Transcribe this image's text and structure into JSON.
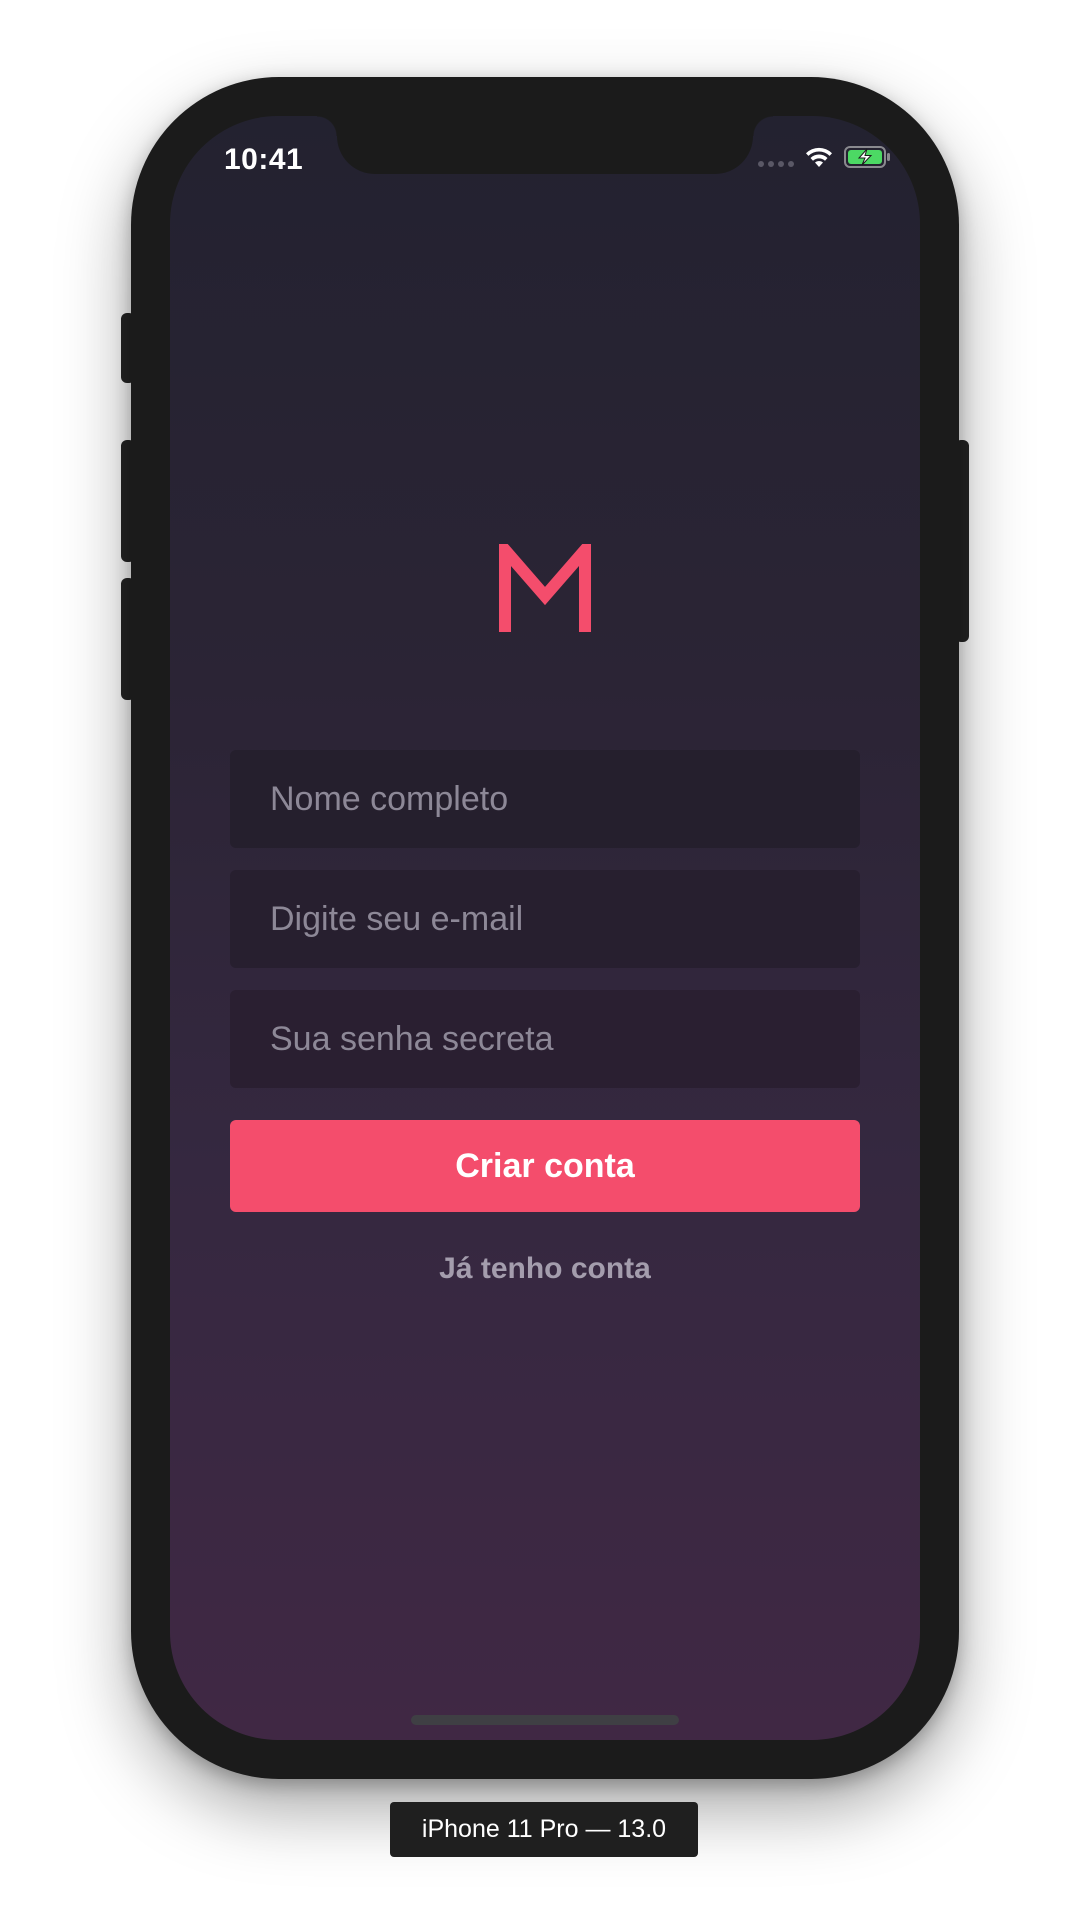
{
  "status_bar": {
    "time": "10:41",
    "icons": [
      "signal-icon",
      "wifi-icon",
      "battery-charging-icon"
    ]
  },
  "app": {
    "logo_letter": "M",
    "accent_color": "#F44D6C"
  },
  "form": {
    "name_placeholder": "Nome completo",
    "email_placeholder": "Digite seu e-mail",
    "password_placeholder": "Sua senha secreta",
    "submit_label": "Criar conta",
    "login_link_label": "Já tenho conta"
  },
  "device": {
    "label": "iPhone 11 Pro — 13.0"
  }
}
